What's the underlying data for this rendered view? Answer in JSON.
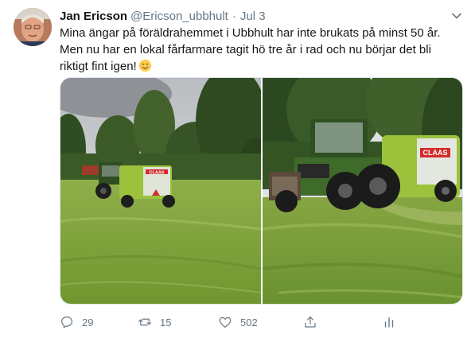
{
  "tweet": {
    "author_name": "Jan Ericson",
    "author_handle": "@Ericson_ubbhult",
    "separator": "·",
    "date": "Jul 3",
    "text_lines": [
      "Mina ängar på föräldrahemmet i Ubbhult har inte brukats på minst 50 år.",
      "Men nu har en lokal fårfarmare tagit hö tre år i rad och nu börjar det bli",
      "riktigt fint igen!"
    ],
    "emoji_icon": "smiling-face-emoji",
    "media": {
      "photos": [
        {
          "subject": "tractor-with-baler-in-meadow",
          "brand_text": "CLAAS"
        },
        {
          "subject": "tractor-with-baler-closeup",
          "brand_text": "CLAAS"
        }
      ]
    },
    "actions": {
      "reply_count": "29",
      "retweet_count": "15",
      "like_count": "502",
      "share_icon": "share-icon",
      "analytics_icon": "analytics-icon"
    }
  },
  "colors": {
    "text_primary": "#14171a",
    "text_secondary": "#657786",
    "border": "#e1e8ed",
    "background": "#ffffff",
    "grass": "#7aa03a",
    "baler": "#9cc23c",
    "tractor": "#3f6b2a"
  }
}
